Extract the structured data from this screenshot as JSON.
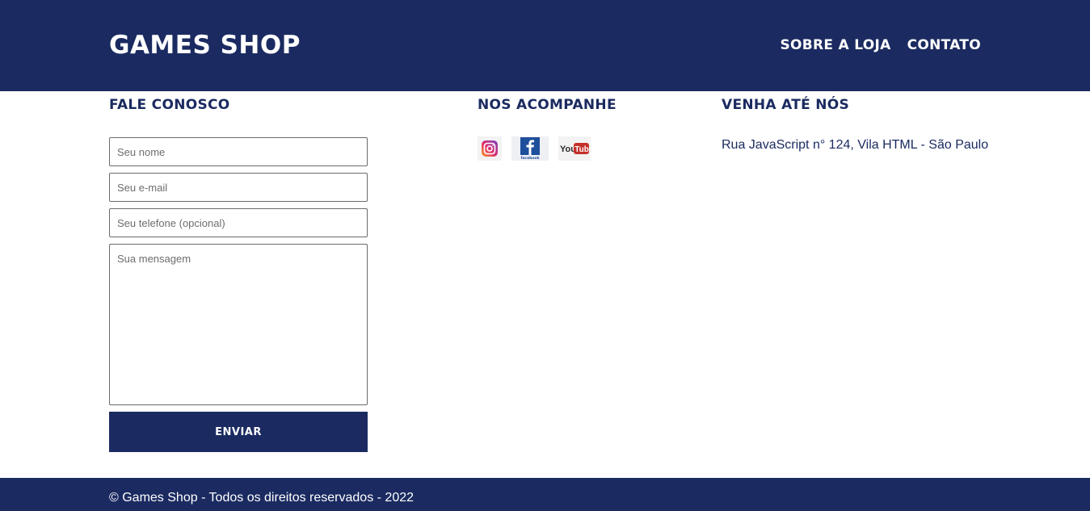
{
  "header": {
    "logo": "GAMES SHOP",
    "nav": [
      {
        "label": "SOBRE A LOJA"
      },
      {
        "label": "CONTATO"
      }
    ]
  },
  "contact": {
    "heading": "FALE CONOSCO",
    "name_placeholder": "Seu nome",
    "email_placeholder": "Seu e-mail",
    "phone_placeholder": "Seu telefone (opcional)",
    "message_placeholder": "Sua mensagem",
    "submit_label": "ENVIAR"
  },
  "social": {
    "heading": "NOS ACOMPANHE",
    "items": [
      {
        "icon": "instagram-icon"
      },
      {
        "icon": "facebook-icon",
        "caption": "facebook"
      },
      {
        "icon": "youtube-icon",
        "text_you": "You",
        "text_tube": "Tube"
      }
    ]
  },
  "location": {
    "heading": "VENHA ATÉ NÓS",
    "address": "Rua JavaScript n° 124, Vila HTML - São Paulo"
  },
  "footer": {
    "copyright": "© Games Shop - Todos os direitos reservados - 2022"
  },
  "colors": {
    "brand": "#1b2b61",
    "text_light": "#ffffff",
    "border": "#6b6b6b"
  }
}
